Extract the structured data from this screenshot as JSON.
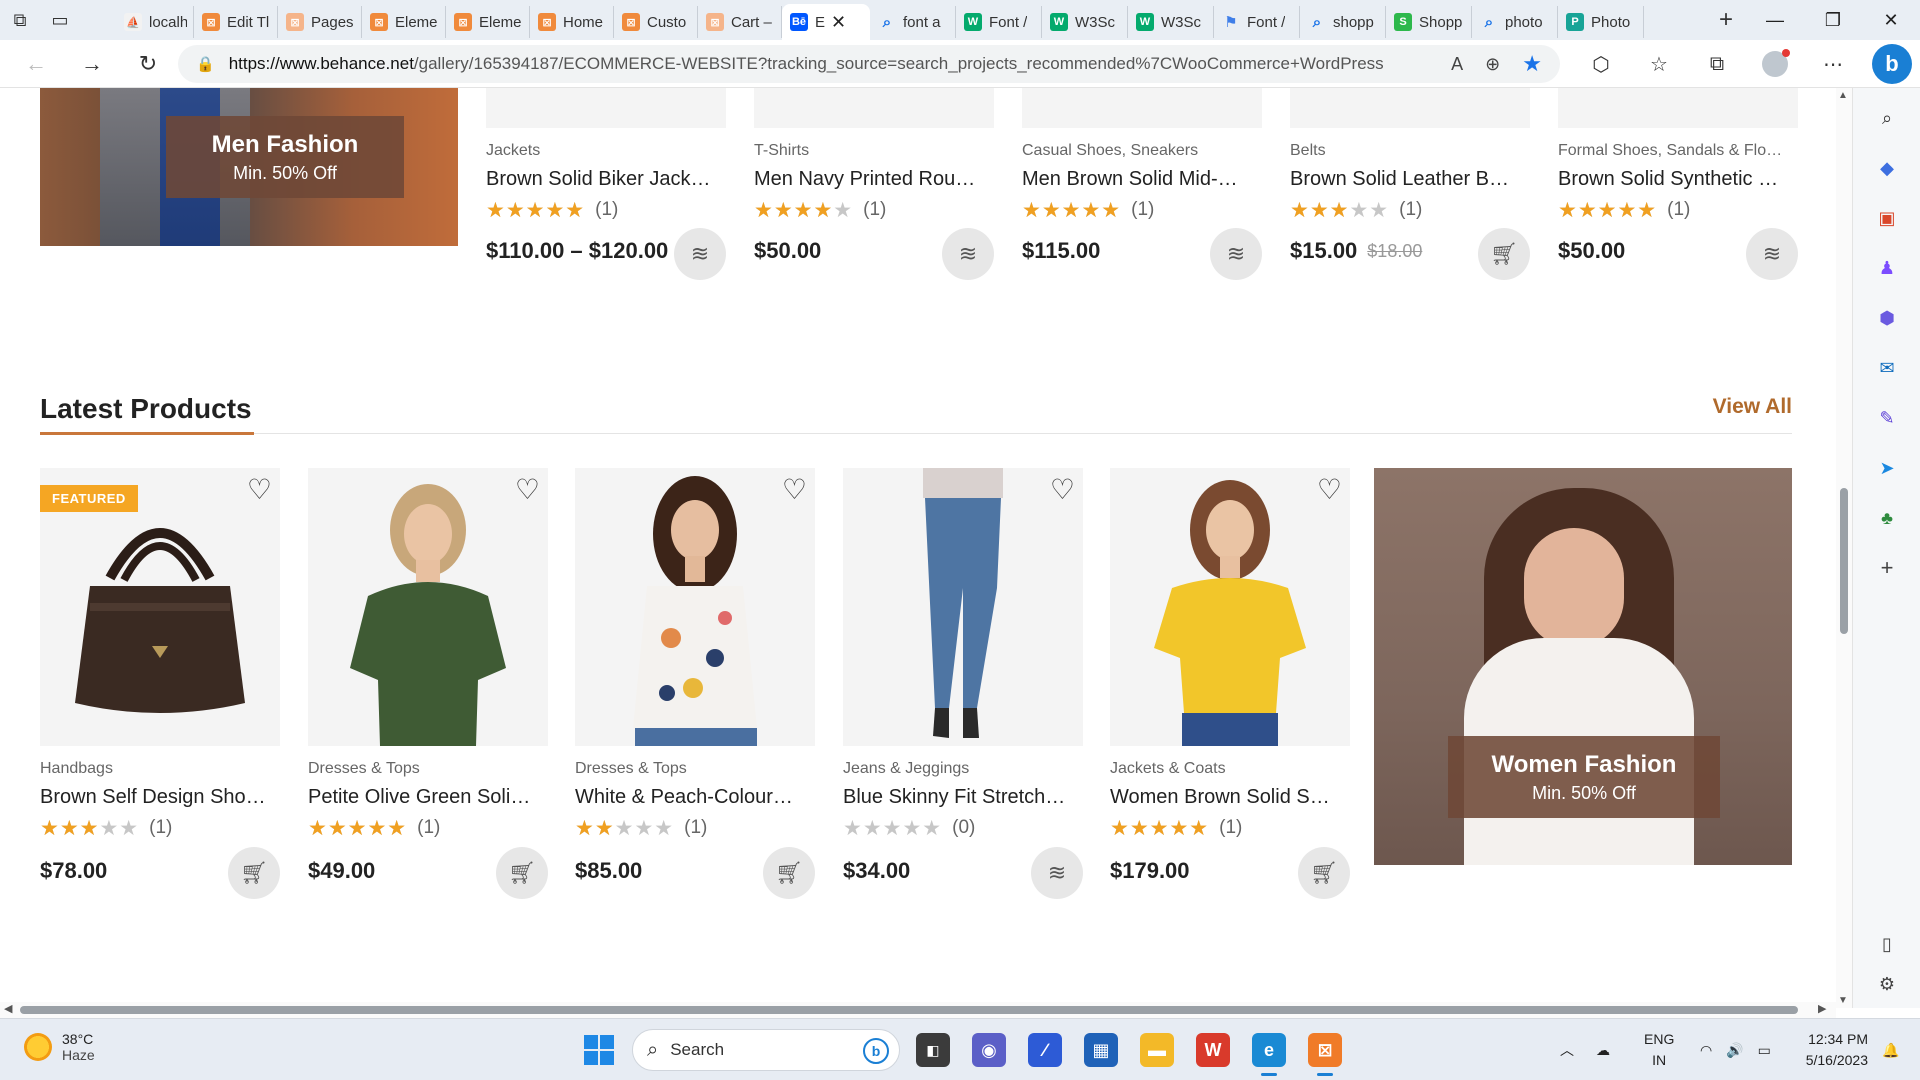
{
  "browser": {
    "tabs": [
      {
        "label": "localh",
        "favicon": "pma-icon",
        "color": "#f2f2f2"
      },
      {
        "label": "Edit Tl",
        "favicon": "elementor-icon",
        "color": "#f08a3c"
      },
      {
        "label": "Pages",
        "favicon": "elementor-icon",
        "color": "#f5b48a"
      },
      {
        "label": "Eleme",
        "favicon": "elementor-icon",
        "color": "#f08a3c"
      },
      {
        "label": "Eleme",
        "favicon": "elementor-icon",
        "color": "#f08a3c"
      },
      {
        "label": "Home",
        "favicon": "elementor-icon",
        "color": "#f08a3c"
      },
      {
        "label": "Custo",
        "favicon": "elementor-icon",
        "color": "#f08a3c"
      },
      {
        "label": "Cart –",
        "favicon": "elementor-icon",
        "color": "#f5b48a"
      },
      {
        "label": "E",
        "favicon": "behance-icon",
        "color": "#0057ff",
        "active": true
      },
      {
        "label": "font a",
        "favicon": "search-icon",
        "color": "#1a73e8"
      },
      {
        "label": "Font /",
        "favicon": "w3schools-icon",
        "color": "#04aa6d"
      },
      {
        "label": "W3Sc",
        "favicon": "w3schools-icon",
        "color": "#04aa6d"
      },
      {
        "label": "W3Sc",
        "favicon": "w3schools-icon",
        "color": "#04aa6d"
      },
      {
        "label": "Font /",
        "favicon": "flag-icon",
        "color": "#3f7ee8"
      },
      {
        "label": "shopp",
        "favicon": "search-icon",
        "color": "#1a73e8"
      },
      {
        "label": "Shopp",
        "favicon": "shopify-icon",
        "color": "#2db84c"
      },
      {
        "label": "photo",
        "favicon": "search-icon",
        "color": "#1a73e8"
      },
      {
        "label": "Photo",
        "favicon": "photopea-icon",
        "color": "#18a497"
      }
    ],
    "url_host": "https://www.behance.net",
    "url_path": "/gallery/165394187/ECOMMERCE-WEBSITE?tracking_source=search_projects_recommended%7CWooCommerce+WordPress"
  },
  "top_banner": {
    "title": "Men Fashion",
    "subtitle": "Min. 50% Off"
  },
  "top_products": [
    {
      "category": "Jackets",
      "name": "Brown Solid Biker Jack…",
      "rating": 5,
      "reviews": "(1)",
      "price": "$110.00 – $120.00",
      "old_price": "",
      "action": "options"
    },
    {
      "category": "T-Shirts",
      "name": "Men Navy Printed Rou…",
      "rating": 4,
      "reviews": "(1)",
      "price": "$50.00",
      "old_price": "",
      "action": "options"
    },
    {
      "category": "Casual Shoes, Sneakers",
      "name": "Men Brown Solid Mid-…",
      "rating": 5,
      "reviews": "(1)",
      "price": "$115.00",
      "old_price": "",
      "action": "options"
    },
    {
      "category": "Belts",
      "name": "Brown Solid Leather B…",
      "rating": 3,
      "reviews": "(1)",
      "price": "$15.00",
      "old_price": "$18.00",
      "action": "cart"
    },
    {
      "category": "Formal Shoes, Sandals & Flo…",
      "name": "Brown Solid Synthetic …",
      "rating": 5,
      "reviews": "(1)",
      "price": "$50.00",
      "old_price": "",
      "action": "options"
    }
  ],
  "latest": {
    "title": "Latest Products",
    "view_all": "View All",
    "featured_badge": "FEATURED",
    "products": [
      {
        "category": "Handbags",
        "name": "Brown Self Design Sho…",
        "rating": 3,
        "reviews": "(1)",
        "price": "$78.00",
        "action": "cart",
        "figure": "handbag"
      },
      {
        "category": "Dresses & Tops",
        "name": "Petite Olive Green Soli…",
        "rating": 5,
        "reviews": "(1)",
        "price": "$49.00",
        "action": "cart",
        "figure": "green-top"
      },
      {
        "category": "Dresses & Tops",
        "name": "White & Peach-Colour…",
        "rating": 2,
        "reviews": "(1)",
        "price": "$85.00",
        "action": "cart",
        "figure": "floral-top"
      },
      {
        "category": "Jeans & Jeggings",
        "name": "Blue Skinny Fit Stretch…",
        "rating": 0,
        "reviews": "(0)",
        "price": "$34.00",
        "action": "options",
        "figure": "jeans"
      },
      {
        "category": "Jackets & Coats",
        "name": "Women Brown Solid S…",
        "rating": 5,
        "reviews": "(1)",
        "price": "$179.00",
        "action": "cart",
        "figure": "yellow-top"
      }
    ]
  },
  "women_banner": {
    "title": "Women Fashion",
    "subtitle": "Min. 50% Off"
  },
  "taskbar": {
    "weather_temp": "38°C",
    "weather_desc": "Haze",
    "search_placeholder": "Search",
    "lang_line1": "ENG",
    "lang_line2": "IN",
    "time": "12:34 PM",
    "date": "5/16/2023"
  }
}
